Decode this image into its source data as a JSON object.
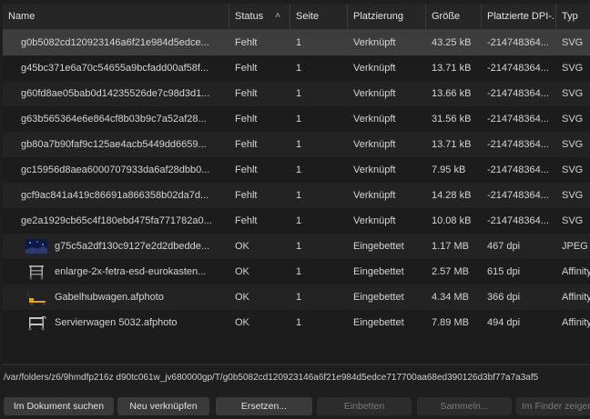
{
  "headers": {
    "name": "Name",
    "status": "Status",
    "seite": "Seite",
    "platzierung": "Platzierung",
    "groesse": "Größe",
    "dpi": "Platzierte DPI-...",
    "typ": "Typ",
    "sort_icon": "chevron-up-icon"
  },
  "rows": [
    {
      "name": "g0b5082cd120923146a6f21e984d5edce...",
      "status": "Fehlt",
      "seite": "1",
      "platzierung": "Verknüpft",
      "size": "43.25 kB",
      "dpi": "-214748364...",
      "typ": "SVG",
      "thumb": null
    },
    {
      "name": "g45bc371e6a70c54655a9bcfadd00af58f...",
      "status": "Fehlt",
      "seite": "1",
      "platzierung": "Verknüpft",
      "size": "13.71 kB",
      "dpi": "-214748364...",
      "typ": "SVG",
      "thumb": null
    },
    {
      "name": "g60fd8ae05bab0d14235526de7c98d3d1...",
      "status": "Fehlt",
      "seite": "1",
      "platzierung": "Verknüpft",
      "size": "13.66 kB",
      "dpi": "-214748364...",
      "typ": "SVG",
      "thumb": null
    },
    {
      "name": "g63b565364e6e864cf8b03b9c7a52af28...",
      "status": "Fehlt",
      "seite": "1",
      "platzierung": "Verknüpft",
      "size": "31.56 kB",
      "dpi": "-214748364...",
      "typ": "SVG",
      "thumb": null
    },
    {
      "name": "gb80a7b90faf9c125ae4acb5449dd6659...",
      "status": "Fehlt",
      "seite": "1",
      "platzierung": "Verknüpft",
      "size": "13.71 kB",
      "dpi": "-214748364...",
      "typ": "SVG",
      "thumb": null
    },
    {
      "name": "gc15956d8aea6000707933da6af28dbb0...",
      "status": "Fehlt",
      "seite": "1",
      "platzierung": "Verknüpft",
      "size": "7.95 kB",
      "dpi": "-214748364...",
      "typ": "SVG",
      "thumb": null
    },
    {
      "name": "gcf9ac841a419c86691a866358b02da7d...",
      "status": "Fehlt",
      "seite": "1",
      "platzierung": "Verknüpft",
      "size": "14.28 kB",
      "dpi": "-214748364...",
      "typ": "SVG",
      "thumb": null
    },
    {
      "name": "ge2a1929cb65c4f180ebd475fa771782a0...",
      "status": "Fehlt",
      "seite": "1",
      "platzierung": "Verknüpft",
      "size": "10.08 kB",
      "dpi": "-214748364...",
      "typ": "SVG",
      "thumb": null
    },
    {
      "name": "g75c5a2df130c9127e2d2dbedde...",
      "status": "OK",
      "seite": "1",
      "platzierung": "Eingebettet",
      "size": "1.17 MB",
      "dpi": "467 dpi",
      "typ": "JPEG",
      "thumb": "night-sky-thumbnail"
    },
    {
      "name": "enlarge-2x-fetra-esd-eurokasten...",
      "status": "OK",
      "seite": "1",
      "platzierung": "Eingebettet",
      "size": "2.57 MB",
      "dpi": "615 dpi",
      "typ": "Affinity",
      "thumb": "cart-thumbnail"
    },
    {
      "name": "Gabelhubwagen.afphoto",
      "status": "OK",
      "seite": "1",
      "platzierung": "Eingebettet",
      "size": "4.34 MB",
      "dpi": "366 dpi",
      "typ": "Affinity",
      "thumb": "pallet-jack-thumbnail"
    },
    {
      "name": "Servierwagen 5032.afphoto",
      "status": "OK",
      "seite": "1",
      "platzierung": "Eingebettet",
      "size": "7.89 MB",
      "dpi": "494 dpi",
      "typ": "Affinity",
      "thumb": "serving-cart-thumbnail"
    }
  ],
  "selected_row": 0,
  "path": "/var/folders/z6/9hmdfp216z d90tc061w_jv680000gp/T/g0b5082cd120923146a6f21e984d5edce717700aa68ed390126d3bf77a7a3af5",
  "buttons": {
    "search": "Im Dokument suchen",
    "relink": "Neu verknüpfen",
    "replace": "Ersetzen...",
    "embed": "Einbetten",
    "collect": "Sammeln...",
    "finder": "Im Finder zeigen"
  },
  "colors": {
    "background": "#1e1e1e",
    "selected": "#3d3d3d",
    "header": "#262626"
  }
}
